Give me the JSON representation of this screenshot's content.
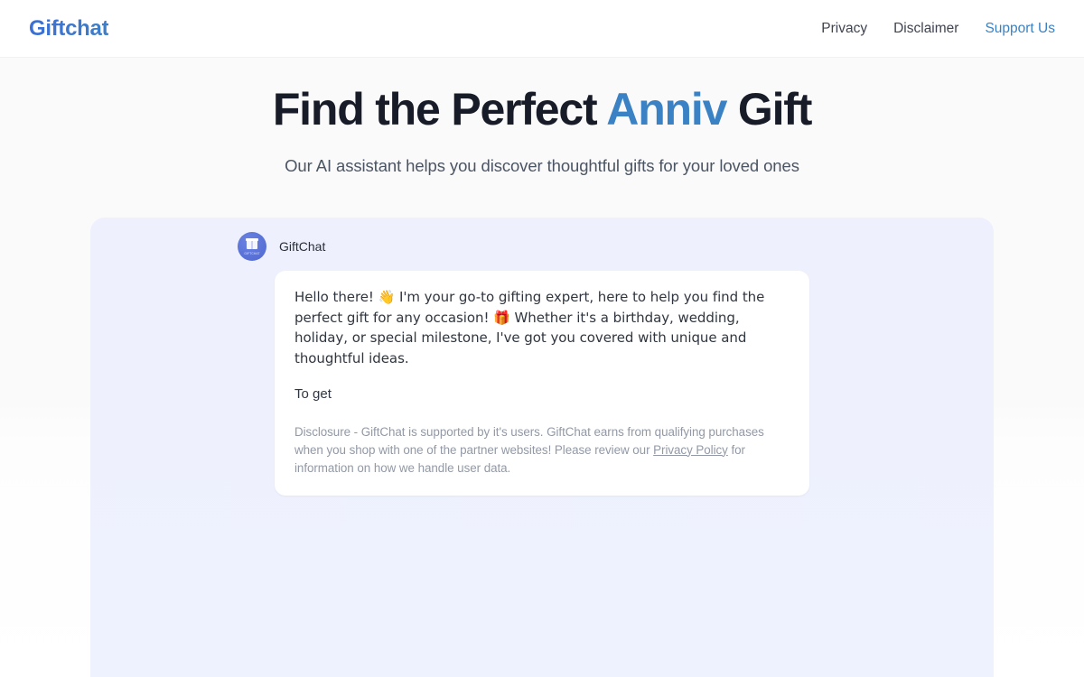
{
  "header": {
    "brand": "Giftchat",
    "brand_color": "#3b74cf",
    "nav": [
      {
        "label": "Privacy",
        "accent": false
      },
      {
        "label": "Disclaimer",
        "accent": false
      },
      {
        "label": "Support Us",
        "accent": true
      }
    ],
    "accent_color": "#3b82c4"
  },
  "hero": {
    "title_part1": "Find the Perfect ",
    "title_highlight": "Anniv",
    "title_part2": " Gift",
    "subtitle": "Our AI assistant helps you discover thoughtful gifts for your loved ones",
    "highlight_color": "#3b82c4",
    "title_color": "#171c28"
  },
  "chat": {
    "panel_bg": "#eef1fd",
    "message": {
      "avatar_icon": "gift-box-icon",
      "avatar_color": "#5b73d8",
      "avatar_tag": "GIFTCHAT",
      "agent_name": "GiftChat",
      "body": "Hello there! 👋 I'm your go-to gifting expert, here to help you find the perfect gift for any occasion! 🎁 Whether it's a birthday, wedding, holiday, or special milestone, I've got you covered with unique and thoughtful ideas.",
      "continuation": "To get",
      "disclosure_before": "Disclosure - GiftChat is supported by it's users. GiftChat earns from qualifying purchases when you shop with one of the partner websites! Please review our ",
      "disclosure_link": "Privacy Policy",
      "disclosure_after": " for information on how we handle user data."
    }
  }
}
